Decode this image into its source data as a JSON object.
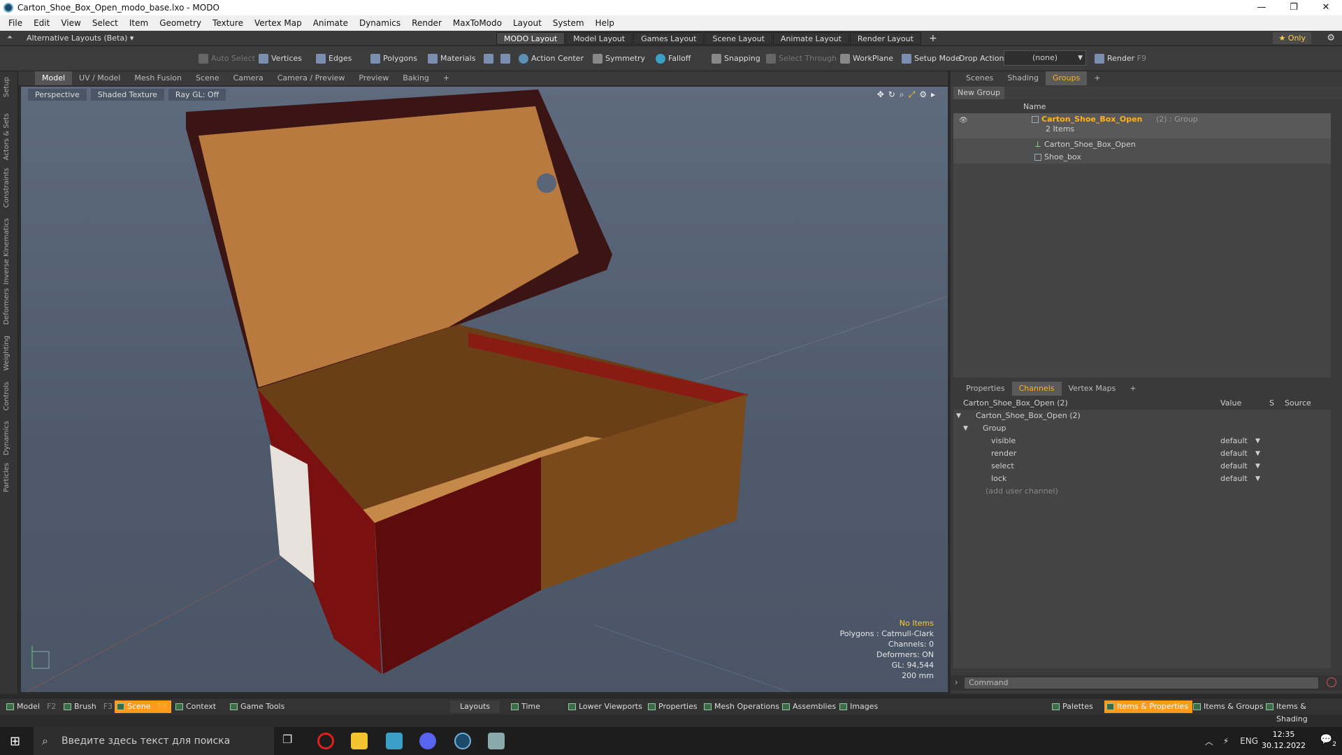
{
  "window": {
    "title": "Carton_Shoe_Box_Open_modo_base.lxo - MODO",
    "controls": [
      "—",
      "❐",
      "✕"
    ]
  },
  "menu": [
    "File",
    "Edit",
    "View",
    "Select",
    "Item",
    "Geometry",
    "Texture",
    "Vertex Map",
    "Animate",
    "Dynamics",
    "Render",
    "MaxToModo",
    "Layout",
    "System",
    "Help"
  ],
  "layoutbar": {
    "alt_layouts": "Alternative Layouts (Beta) ▾",
    "tabs": [
      "MODO Layout",
      "Model Layout",
      "Games Layout",
      "Scene Layout",
      "Animate Layout",
      "Render Layout",
      "+"
    ],
    "only": "★ Only"
  },
  "toolbar": {
    "auto_select": "Auto Select",
    "vertices": "Vertices",
    "edges": "Edges",
    "polygons": "Polygons",
    "materials": "Materials",
    "action_center": "Action Center",
    "symmetry": "Symmetry",
    "falloff": "Falloff",
    "snapping": "Snapping",
    "select_through": "Select Through",
    "workplane": "WorkPlane",
    "setup_mode": "Setup Mode",
    "drop_action": "Drop Action",
    "drop_value": "(none)",
    "render": "Render",
    "render_key": "F9"
  },
  "left_tabs": [
    "Setup",
    "Actors & Sets",
    "Constraints",
    "Inverse Kinematics",
    "Deformers",
    "Weighting",
    "Controls",
    "Dynamics",
    "Particles"
  ],
  "viewport_tabs": [
    "Model",
    "UV / Model",
    "Mesh Fusion",
    "Scene",
    "Camera",
    "Camera / Preview",
    "Preview",
    "Baking",
    "+"
  ],
  "viewport_header": {
    "view": "Perspective",
    "shading": "Shaded Texture",
    "raygl": "Ray GL: Off"
  },
  "viewport_info": {
    "items": "No Items",
    "polygons": "Polygons : Catmull-Clark",
    "channels": "Channels: 0",
    "deformers": "Deformers: ON",
    "gl": "GL: 94,544",
    "scale": "200 mm"
  },
  "scene_panel": {
    "tabs": [
      "Scenes",
      "Shading",
      "Groups",
      "+"
    ],
    "new_group": "New Group",
    "col_name": "Name",
    "group_name": "Carton_Shoe_Box_Open",
    "group_suffix": "(2) : Group",
    "group_count": "2 Items",
    "children": [
      "Carton_Shoe_Box_Open",
      "Shoe_box"
    ]
  },
  "channels_panel": {
    "tabs": [
      "Properties",
      "Channels",
      "Vertex Maps",
      "+"
    ],
    "header_name": "Carton_Shoe_Box_Open (2)",
    "header_value": "Value",
    "header_s": "S",
    "header_source": "Source",
    "root": "Carton_Shoe_Box_Open (2)",
    "group": "Group",
    "channels": [
      {
        "name": "visible",
        "value": "default"
      },
      {
        "name": "render",
        "value": "default"
      },
      {
        "name": "select",
        "value": "default"
      },
      {
        "name": "lock",
        "value": "default"
      }
    ],
    "add_user": "(add user channel)"
  },
  "command": {
    "placeholder": "Command"
  },
  "bottombar": {
    "model": "Model",
    "model_key": "F2",
    "brush": "Brush",
    "brush_key": "F3",
    "scene": "Scene",
    "scene_key": "F4",
    "context": "Context",
    "game_tools": "Game Tools",
    "layouts": "Layouts",
    "time": "Time",
    "lower_viewports": "Lower Viewports",
    "properties": "Properties",
    "mesh_operations": "Mesh Operations",
    "assemblies": "Assemblies",
    "images": "Images",
    "palettes": "Palettes",
    "items_properties": "Items & Properties",
    "items_groups": "Items & Groups",
    "items_shading": "Items & Shading"
  },
  "taskbar": {
    "search_placeholder": "Введите здесь текст для поиска",
    "lang": "ENG",
    "time": "12:35",
    "date": "30.12.2022",
    "notif": "2"
  },
  "colors": {
    "accent": "#ff9a1a",
    "group_name": "#ffb21a",
    "info_highlight": "#ffcc33"
  }
}
